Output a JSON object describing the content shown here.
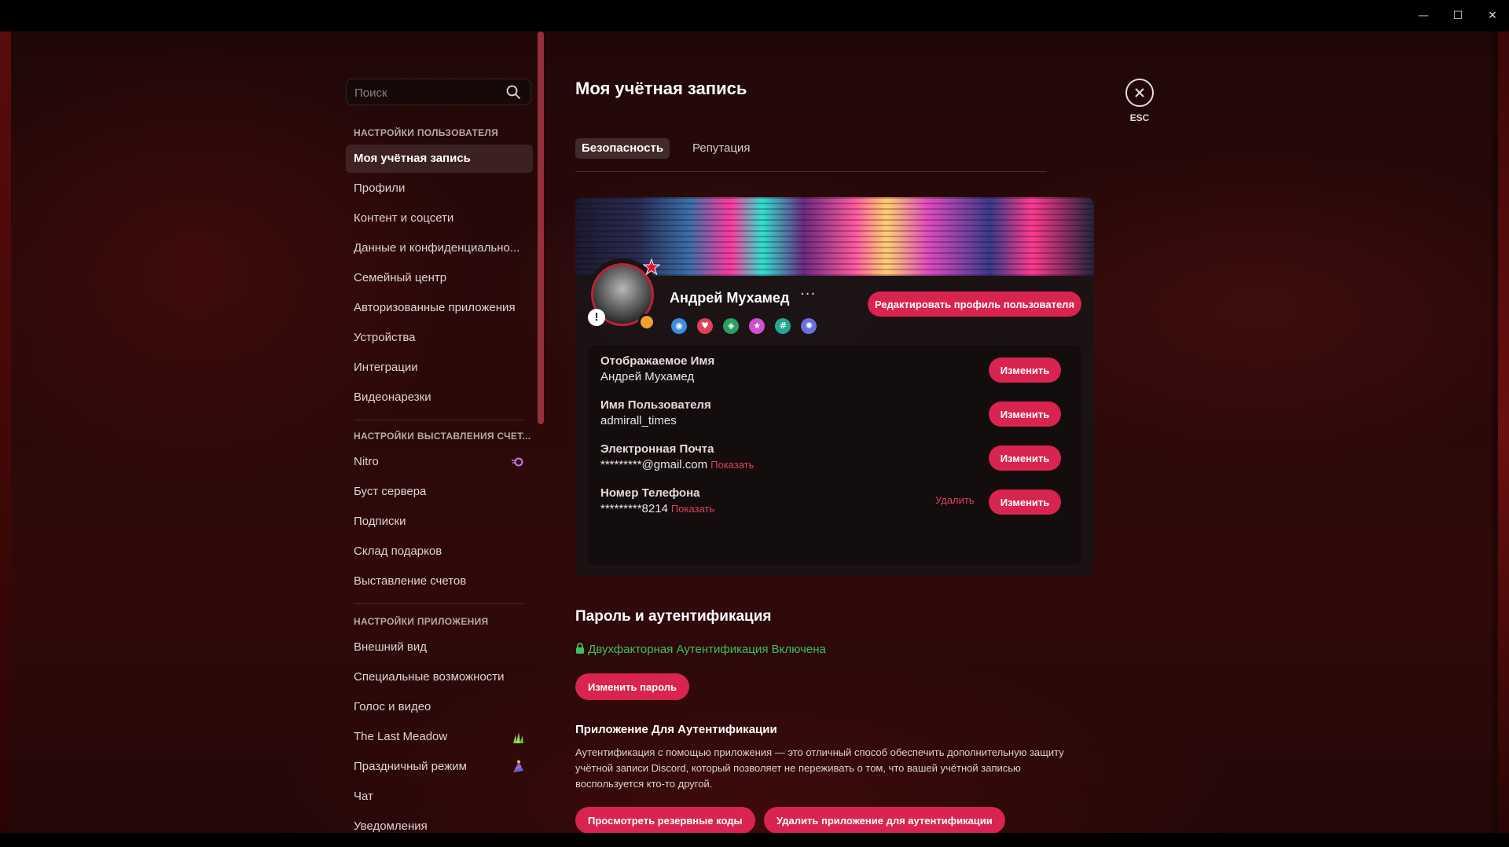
{
  "window": {
    "minimize": "—",
    "maximize": "☐",
    "close": "✕"
  },
  "sidebar": {
    "search_placeholder": "Поиск",
    "user_settings_title": "НАСТРОЙКИ ПОЛЬЗОВАТЕЛЯ",
    "user_items": [
      "Моя учётная запись",
      "Профили",
      "Контент и соцсети",
      "Данные и конфиденциально...",
      "Семейный центр",
      "Авторизованные приложения",
      "Устройства",
      "Интеграции",
      "Видеонарезки"
    ],
    "billing_title": "НАСТРОЙКИ ВЫСТАВЛЕНИЯ СЧЕТ...",
    "billing_items": [
      "Nitro",
      "Буст сервера",
      "Подписки",
      "Склад подарков",
      "Выставление счетов"
    ],
    "app_title": "НАСТРОЙКИ ПРИЛОЖЕНИЯ",
    "app_items": [
      "Внешний вид",
      "Специальные возможности",
      "Голос и видео",
      "The Last Meadow",
      "Праздничный режим",
      "Чат",
      "Уведомления"
    ]
  },
  "main": {
    "title": "Моя учётная запись",
    "esc": "ESC",
    "tabs": [
      {
        "label": "Безопасность",
        "active": true
      },
      {
        "label": "Репутация",
        "active": false
      }
    ],
    "profile": {
      "display_name": "Андрей Мухамед",
      "more": "···",
      "edit_button": "Редактировать профиль пользователя",
      "warning_badge": "!"
    },
    "fields": [
      {
        "label": "Отображаемое Имя",
        "value": "Андрей Мухамед",
        "button": "Изменить"
      },
      {
        "label": "Имя Пользователя",
        "value": "admirall_times",
        "button": "Изменить"
      },
      {
        "label": "Электронная Почта",
        "value": "*********@gmail.com",
        "reveal": "Показать",
        "button": "Изменить"
      },
      {
        "label": "Номер Телефона",
        "value": "*********8214",
        "reveal": "Показать",
        "remove": "Удалить",
        "button": "Изменить"
      }
    ],
    "password_section": {
      "title": "Пароль и аутентификация",
      "twofa_status": "Двухфакторная Аутентификация Включена",
      "change_password": "Изменить пароль",
      "auth_app_title": "Приложение Для Аутентификации",
      "auth_app_desc": "Аутентификация с помощью приложения — это отличный способ обеспечить дополнительную защиту учётной записи Discord, который позволяет не переживать о том, что вашей учётной записью воспользуется кто-то другой.",
      "backup_codes": "Просмотреть резервные коды",
      "remove_auth_app": "Удалить приложение для аутентификации"
    }
  },
  "colors": {
    "accent": "#d8244e",
    "success": "#3fbf60",
    "link": "#e0405a"
  }
}
